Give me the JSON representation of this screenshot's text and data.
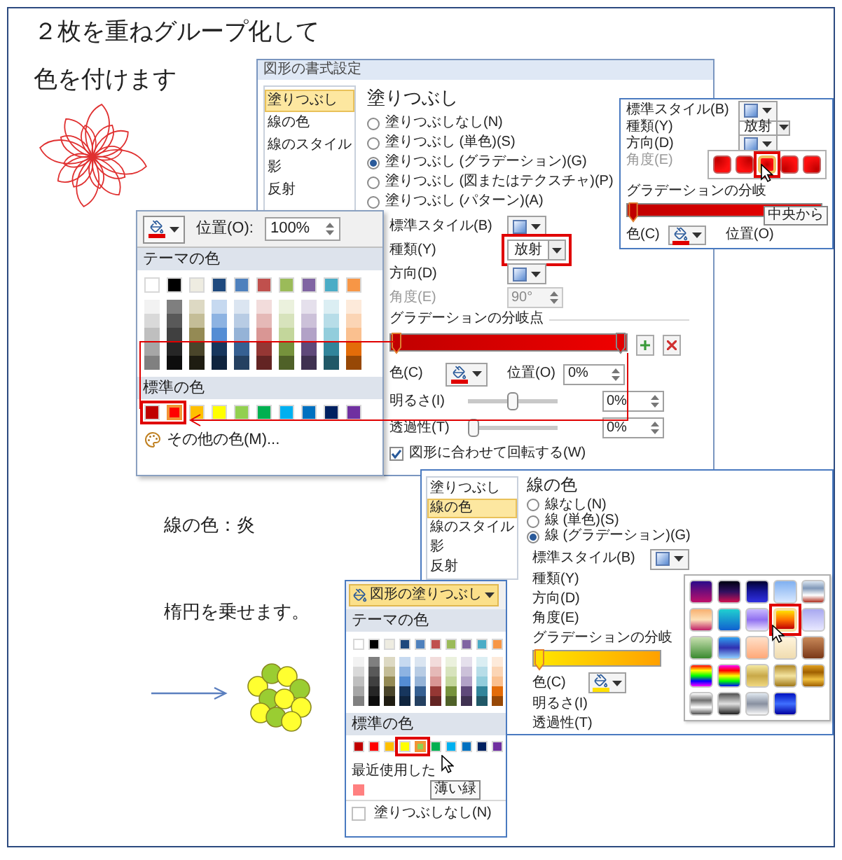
{
  "heading": {
    "lines": [
      "２枚を重ねグループ化して",
      "色を付けます"
    ]
  },
  "fill_dialog": {
    "title": "図形の書式設定",
    "nav": [
      {
        "label": "塗りつぶし",
        "selected": true
      },
      {
        "label": "線の色",
        "selected": false
      },
      {
        "label": "線のスタイル",
        "selected": false
      },
      {
        "label": "影",
        "selected": false
      },
      {
        "label": "反射",
        "selected": false
      }
    ],
    "heading": "塗りつぶし",
    "options": [
      {
        "label": "塗りつぶしなし(N)",
        "selected": false
      },
      {
        "label": "塗りつぶし (単色)(S)",
        "selected": false
      },
      {
        "label": "塗りつぶし (グラデーション)(G)",
        "selected": true
      },
      {
        "label": "塗りつぶし (図またはテクスチャ)(P)",
        "selected": false
      },
      {
        "label": "塗りつぶし (パターン)(A)",
        "selected": false
      }
    ],
    "rows": [
      {
        "kind": "swatch",
        "label": "標準スタイル(B)",
        "disabled": false,
        "highlighted": false
      },
      {
        "kind": "select",
        "label": "種類(Y)",
        "value": "放射",
        "disabled": false,
        "highlighted": true
      },
      {
        "kind": "swatch",
        "label": "方向(D)",
        "disabled": false,
        "highlighted": false
      },
      {
        "kind": "spin",
        "label": "角度(E)",
        "value": "90°",
        "disabled": true,
        "highlighted": false
      }
    ],
    "stops_label": "グラデーションの分岐点",
    "color_label": "色(C)",
    "position_label": "位置(O)",
    "position_value": "0%",
    "sliders": [
      {
        "label": "明るさ(I)",
        "level": 0.5,
        "value": "0%"
      },
      {
        "label": "透過性(T)",
        "level": 0,
        "value": "0%"
      }
    ],
    "rotate": {
      "label": "図形に合わせて回転する(W)",
      "checked": true
    }
  },
  "gradient_inset": {
    "rows": [
      {
        "kind": "swatch",
        "label": "標準スタイル(B)",
        "disabled": false
      },
      {
        "kind": "select",
        "label": "種類(Y)",
        "value": "放射",
        "disabled": false
      },
      {
        "kind": "swatch",
        "label": "方向(D)",
        "disabled": false
      },
      {
        "kind": "label",
        "label": "角度(E)",
        "disabled": true
      }
    ],
    "stops_label": "グラデーションの分岐",
    "swatches": [
      {
        "selected": false,
        "highlighted": false
      },
      {
        "selected": false,
        "highlighted": false
      },
      {
        "selected": true,
        "highlighted": true
      },
      {
        "selected": false,
        "highlighted": false
      },
      {
        "selected": false,
        "highlighted": false
      }
    ],
    "tooltip": "中央から",
    "color_label": "色(C)",
    "position_label": "位置(O)"
  },
  "palette_1": {
    "position_label": "位置(O):",
    "position_value": "100%",
    "theme_label": "テーマの色",
    "theme": [
      {
        "color": "#ffffff",
        "shades": [
          {
            "color": "#f2f2f2"
          },
          {
            "color": "#d9d9d9"
          },
          {
            "color": "#bfbfbf"
          },
          {
            "color": "#a6a6a6"
          },
          {
            "color": "#808080"
          }
        ]
      },
      {
        "color": "#000000",
        "shades": [
          {
            "color": "#7f7f7f"
          },
          {
            "color": "#595959"
          },
          {
            "color": "#404040"
          },
          {
            "color": "#262626"
          },
          {
            "color": "#0d0d0d"
          }
        ]
      },
      {
        "color": "#eeece1",
        "shades": [
          {
            "color": "#ddd9c3"
          },
          {
            "color": "#c4bd97"
          },
          {
            "color": "#948a54"
          },
          {
            "color": "#4a452a"
          },
          {
            "color": "#1e1c11"
          }
        ]
      },
      {
        "color": "#1f497d",
        "shades": [
          {
            "color": "#c6d9f0"
          },
          {
            "color": "#8db3e2"
          },
          {
            "color": "#548dd4"
          },
          {
            "color": "#17365d"
          },
          {
            "color": "#0f243e"
          }
        ]
      },
      {
        "color": "#4f81bd",
        "shades": [
          {
            "color": "#dbe5f1"
          },
          {
            "color": "#b8cce4"
          },
          {
            "color": "#95b3d7"
          },
          {
            "color": "#366092"
          },
          {
            "color": "#244061"
          }
        ]
      },
      {
        "color": "#c0504d",
        "shades": [
          {
            "color": "#f2dcdb"
          },
          {
            "color": "#e5b9b7"
          },
          {
            "color": "#d99694"
          },
          {
            "color": "#953734"
          },
          {
            "color": "#632423"
          }
        ]
      },
      {
        "color": "#9bbb59",
        "shades": [
          {
            "color": "#ebf1dd"
          },
          {
            "color": "#d7e3bc"
          },
          {
            "color": "#c3d69b"
          },
          {
            "color": "#76923c"
          },
          {
            "color": "#4f6128"
          }
        ]
      },
      {
        "color": "#8064a2",
        "shades": [
          {
            "color": "#e5e0ec"
          },
          {
            "color": "#ccc1d9"
          },
          {
            "color": "#b2a2c7"
          },
          {
            "color": "#5f497a"
          },
          {
            "color": "#3f3151"
          }
        ]
      },
      {
        "color": "#4bacc6",
        "shades": [
          {
            "color": "#dbeef3"
          },
          {
            "color": "#b7dde8"
          },
          {
            "color": "#92cddc"
          },
          {
            "color": "#31859b"
          },
          {
            "color": "#205867"
          }
        ]
      },
      {
        "color": "#f79646",
        "shades": [
          {
            "color": "#fdeada"
          },
          {
            "color": "#fbd5b5"
          },
          {
            "color": "#fac08f"
          },
          {
            "color": "#e36c09"
          },
          {
            "color": "#974806"
          }
        ]
      }
    ],
    "standard_label": "標準の色",
    "standard": [
      {
        "color": "#c00000",
        "selected": false,
        "highlighted": true
      },
      {
        "color": "#ff0000",
        "selected": true,
        "highlighted": true
      },
      {
        "color": "#ffc000",
        "selected": false,
        "highlighted": false
      },
      {
        "color": "#ffff00",
        "selected": false,
        "highlighted": false
      },
      {
        "color": "#92d050",
        "selected": false,
        "highlighted": false
      },
      {
        "color": "#00b050",
        "selected": false,
        "highlighted": false
      },
      {
        "color": "#00b0f0",
        "selected": false,
        "highlighted": false
      },
      {
        "color": "#0070c0",
        "selected": false,
        "highlighted": false
      },
      {
        "color": "#002060",
        "selected": false,
        "highlighted": false
      },
      {
        "color": "#7030a0",
        "selected": false,
        "highlighted": false
      }
    ],
    "more": "その他の色(M)..."
  },
  "captions": [
    "線の色：炎",
    "楕円を乗せます。"
  ],
  "line_dialog": {
    "nav": [
      {
        "label": "塗りつぶし",
        "selected": false
      },
      {
        "label": "線の色",
        "selected": true
      },
      {
        "label": "線のスタイル",
        "selected": false
      },
      {
        "label": "影",
        "selected": false
      },
      {
        "label": "反射",
        "selected": false
      }
    ],
    "heading": "線の色",
    "options": [
      {
        "label": "線なし(N)",
        "selected": false
      },
      {
        "label": "線 (単色)(S)",
        "selected": false
      },
      {
        "label": "線 (グラデーション)(G)",
        "selected": true
      }
    ],
    "rows": [
      {
        "kind": "swatch",
        "label": "標準スタイル(B)"
      },
      {
        "kind": "label",
        "label": "種類(Y)"
      },
      {
        "kind": "label",
        "label": "方向(D)"
      },
      {
        "kind": "label",
        "label": "角度(E)"
      }
    ],
    "stops_label": "グラデーションの分岐",
    "color_label": "色(C)",
    "slider_labels": [
      "明るさ(I)",
      "透過性(T)"
    ],
    "presets": [
      {
        "selected": false,
        "highlighted": false
      },
      {
        "selected": false,
        "highlighted": false
      },
      {
        "selected": false,
        "highlighted": false
      },
      {
        "selected": false,
        "highlighted": false
      },
      {
        "selected": false,
        "highlighted": false
      },
      {
        "selected": false,
        "highlighted": false
      },
      {
        "selected": false,
        "highlighted": false
      },
      {
        "selected": false,
        "highlighted": false
      },
      {
        "selected": true,
        "highlighted": true
      },
      {
        "selected": false,
        "highlighted": false
      },
      {
        "selected": false,
        "highlighted": false
      },
      {
        "selected": false,
        "highlighted": false
      },
      {
        "selected": false,
        "highlighted": false
      },
      {
        "selected": false,
        "highlighted": false
      },
      {
        "selected": false,
        "highlighted": false
      },
      {
        "selected": false,
        "highlighted": false
      },
      {
        "selected": false,
        "highlighted": false
      },
      {
        "selected": false,
        "highlighted": false
      },
      {
        "selected": false,
        "highlighted": false
      },
      {
        "selected": false,
        "highlighted": false
      },
      {
        "selected": false,
        "highlighted": false
      },
      {
        "selected": false,
        "highlighted": false
      },
      {
        "selected": false,
        "highlighted": false
      },
      {
        "selected": false,
        "highlighted": false
      }
    ]
  },
  "palette_2": {
    "button": "図形の塗りつぶし",
    "theme_label": "テーマの色",
    "theme": [
      {
        "color": "#ffffff",
        "shades": [
          {
            "color": "#f2f2f2"
          },
          {
            "color": "#d9d9d9"
          },
          {
            "color": "#bfbfbf"
          },
          {
            "color": "#a6a6a6"
          },
          {
            "color": "#808080"
          }
        ]
      },
      {
        "color": "#000000",
        "shades": [
          {
            "color": "#7f7f7f"
          },
          {
            "color": "#595959"
          },
          {
            "color": "#404040"
          },
          {
            "color": "#262626"
          },
          {
            "color": "#0d0d0d"
          }
        ]
      },
      {
        "color": "#eeece1",
        "shades": [
          {
            "color": "#ddd9c3"
          },
          {
            "color": "#c4bd97"
          },
          {
            "color": "#948a54"
          },
          {
            "color": "#4a452a"
          },
          {
            "color": "#1e1c11"
          }
        ]
      },
      {
        "color": "#1f497d",
        "shades": [
          {
            "color": "#c6d9f0"
          },
          {
            "color": "#8db3e2"
          },
          {
            "color": "#548dd4"
          },
          {
            "color": "#17365d"
          },
          {
            "color": "#0f243e"
          }
        ]
      },
      {
        "color": "#4f81bd",
        "shades": [
          {
            "color": "#dbe5f1"
          },
          {
            "color": "#b8cce4"
          },
          {
            "color": "#95b3d7"
          },
          {
            "color": "#366092"
          },
          {
            "color": "#244061"
          }
        ]
      },
      {
        "color": "#c0504d",
        "shades": [
          {
            "color": "#f2dcdb"
          },
          {
            "color": "#e5b9b7"
          },
          {
            "color": "#d99694"
          },
          {
            "color": "#953734"
          },
          {
            "color": "#632423"
          }
        ]
      },
      {
        "color": "#9bbb59",
        "shades": [
          {
            "color": "#ebf1dd"
          },
          {
            "color": "#d7e3bc"
          },
          {
            "color": "#c3d69b"
          },
          {
            "color": "#76923c"
          },
          {
            "color": "#4f6128"
          }
        ]
      },
      {
        "color": "#8064a2",
        "shades": [
          {
            "color": "#e5e0ec"
          },
          {
            "color": "#ccc1d9"
          },
          {
            "color": "#b2a2c7"
          },
          {
            "color": "#5f497a"
          },
          {
            "color": "#3f3151"
          }
        ]
      },
      {
        "color": "#4bacc6",
        "shades": [
          {
            "color": "#dbeef3"
          },
          {
            "color": "#b7dde8"
          },
          {
            "color": "#92cddc"
          },
          {
            "color": "#31859b"
          },
          {
            "color": "#205867"
          }
        ]
      },
      {
        "color": "#f79646",
        "shades": [
          {
            "color": "#fdeada"
          },
          {
            "color": "#fbd5b5"
          },
          {
            "color": "#fac08f"
          },
          {
            "color": "#e36c09"
          },
          {
            "color": "#974806"
          }
        ]
      }
    ],
    "standard_label": "標準の色",
    "standard": [
      {
        "color": "#c00000",
        "selected": false,
        "highlighted": false
      },
      {
        "color": "#ff0000",
        "selected": false,
        "highlighted": false
      },
      {
        "color": "#ffc000",
        "selected": false,
        "highlighted": false
      },
      {
        "color": "#ffff00",
        "selected": false,
        "highlighted": true
      },
      {
        "color": "#92d050",
        "selected": true,
        "highlighted": true
      },
      {
        "color": "#00b050",
        "selected": false,
        "highlighted": false
      },
      {
        "color": "#00b0f0",
        "selected": false,
        "highlighted": false
      },
      {
        "color": "#0070c0",
        "selected": false,
        "highlighted": false
      },
      {
        "color": "#002060",
        "selected": false,
        "highlighted": false
      },
      {
        "color": "#7030a0",
        "selected": false,
        "highlighted": false
      }
    ],
    "recent_label": "最近使用した",
    "recent": [
      {
        "color": "#ff8080"
      }
    ],
    "tooltip": "薄い緑",
    "no_fill": "塗りつぶしなし(N)"
  }
}
